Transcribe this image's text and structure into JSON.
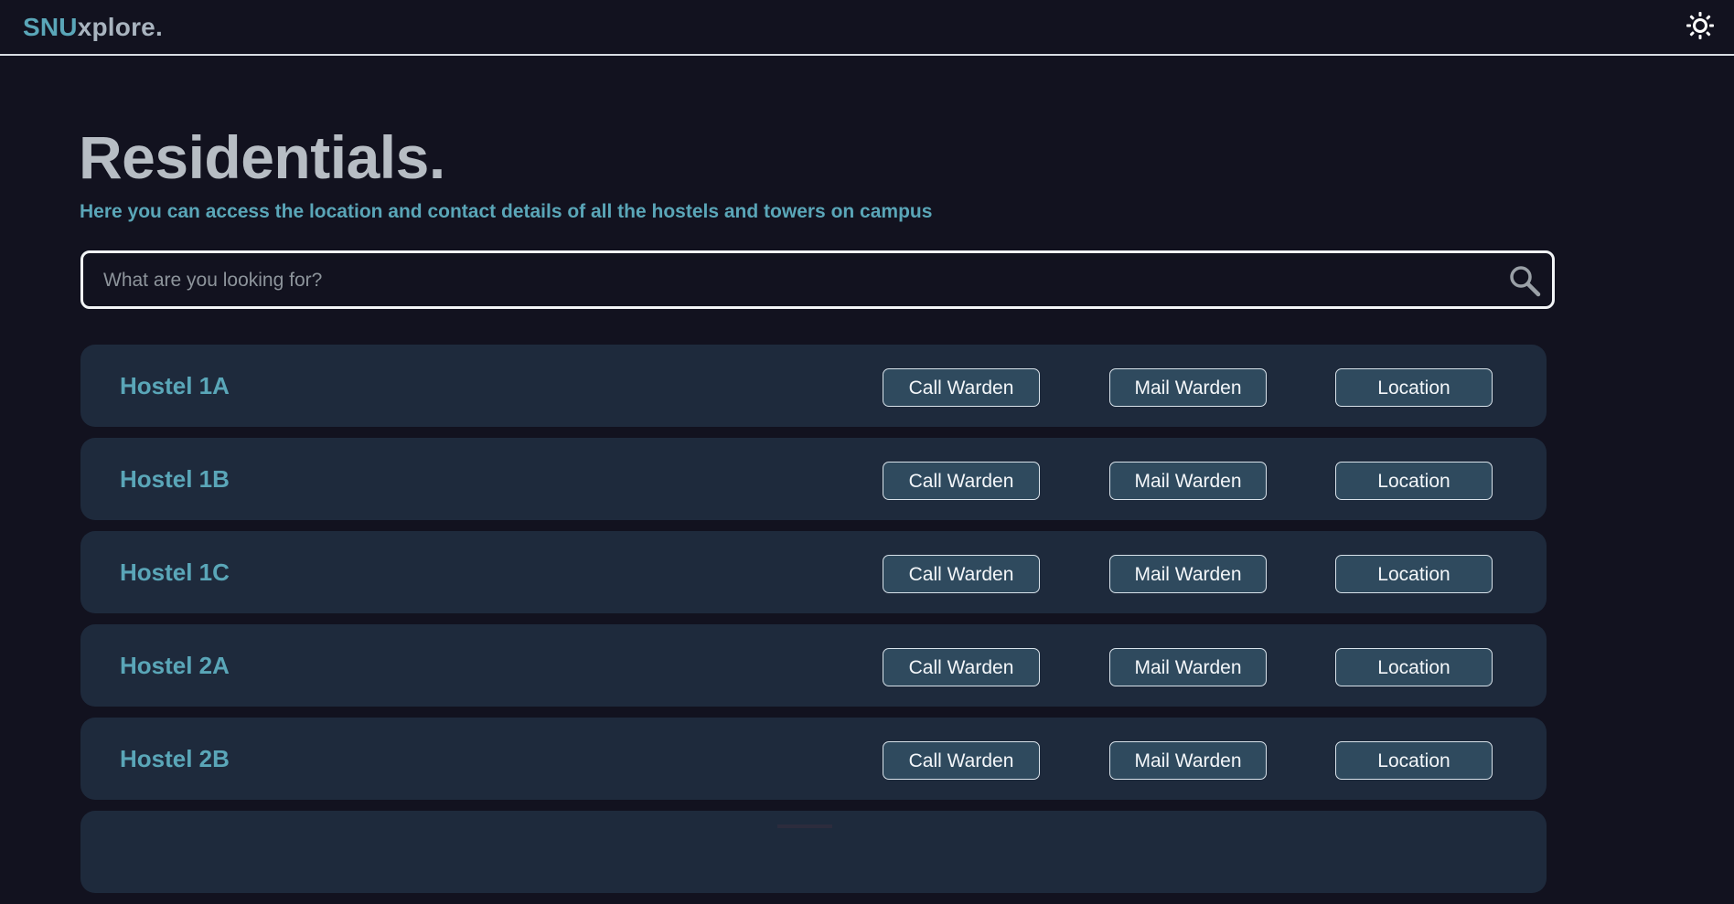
{
  "nav": {
    "brand_prefix": "SNU",
    "brand_suffix": "xplore."
  },
  "page": {
    "title": "Residentials.",
    "subtitle": "Here you can access the location and contact details of all the hostels and towers on campus"
  },
  "search": {
    "placeholder": "What are you looking for?",
    "value": ""
  },
  "actions": {
    "call": "Call Warden",
    "mail": "Mail Warden",
    "location": "Location"
  },
  "hostels": [
    {
      "name": "Hostel 1A"
    },
    {
      "name": "Hostel 1B"
    },
    {
      "name": "Hostel 1C"
    },
    {
      "name": "Hostel 2A"
    },
    {
      "name": "Hostel 2B"
    },
    {
      "name": ""
    }
  ],
  "colors": {
    "background": "#12121f",
    "accent": "#5aa6b8",
    "card": "#1e2a3c",
    "button": "#2f4a5e",
    "title": "#b7bdc4"
  },
  "icons": {
    "theme_toggle": "sun-icon",
    "search": "search-icon"
  }
}
